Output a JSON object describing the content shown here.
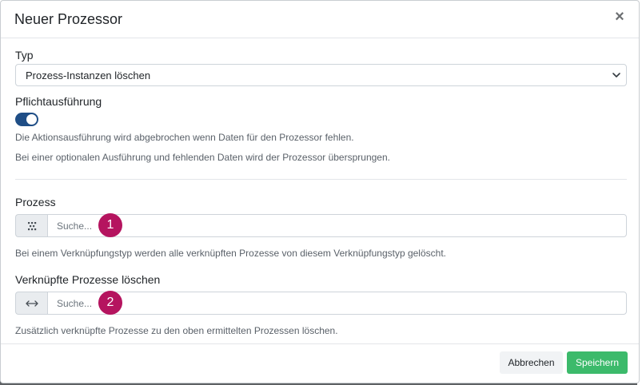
{
  "modal": {
    "title": "Neuer Prozessor",
    "close_icon": "close-icon"
  },
  "typ": {
    "label": "Typ",
    "selected": "Prozess-Instanzen löschen"
  },
  "pflicht": {
    "label": "Pflichtausführung",
    "enabled": true,
    "help_1": "Die Aktionsausführung wird abgebrochen wenn Daten für den Prozessor fehlen.",
    "help_2": "Bei einer optionalen Ausführung und fehlenden Daten wird der Prozessor übersprungen."
  },
  "prozess": {
    "label": "Prozess",
    "icon": "process-grid-icon",
    "placeholder": "Suche...",
    "badge": "1",
    "help": "Bei einem Verknüpfungstyp werden alle verknüpften Prozesse von diesem Verknüpfungstyp gelöscht."
  },
  "verknuepft": {
    "label": "Verknüpfte Prozesse löschen",
    "icon": "link-arrows-icon",
    "placeholder": "Suche...",
    "badge": "2",
    "help": "Zusätzlich verknüpfte Prozesse zu den oben ermittelten Prozessen löschen."
  },
  "footer": {
    "cancel_label": "Abbrechen",
    "save_label": "Speichern"
  },
  "colors": {
    "toggle": "#1f4e86",
    "badge": "#b5145f",
    "save": "#3cba6b"
  }
}
